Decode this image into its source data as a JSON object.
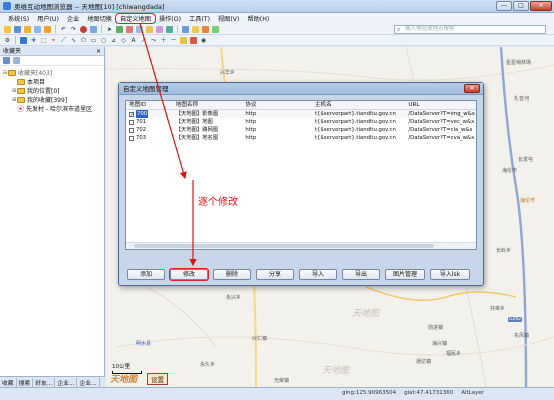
{
  "window": {
    "title": "奥维互动地图浏览器 -- 天地图[10] [chiwangdada]",
    "buttons": [
      "—",
      "□",
      "✕"
    ]
  },
  "menu": {
    "items": [
      "系统(S)",
      "用户(U)",
      "企业",
      "地图切换",
      "自定义地图",
      "操作(O)",
      "工具(T)",
      "视图(V)",
      "帮助(H)"
    ],
    "highlighted_index": 4
  },
  "search": {
    "placeholder": "输入地址或地点搜索"
  },
  "left_panel": {
    "header": "收藏夹",
    "close": "✕",
    "tree": [
      {
        "label": "收藏夹[403]",
        "level": 0,
        "muted": true
      },
      {
        "label": "本项目",
        "level": 1
      },
      {
        "label": "我的位置[0]",
        "level": 1
      },
      {
        "label": "我的收藏[399]",
        "level": 1
      },
      {
        "label": "先发村 - 哈尔滨市道里区",
        "level": 1,
        "pin": true
      }
    ],
    "tabs": [
      "收藏",
      "搜索",
      "好友...",
      "企业...",
      "企业..."
    ]
  },
  "dialog": {
    "title": "自定义地图管理",
    "close": "✕",
    "columns": [
      "地图ID",
      "地图名称",
      "协议",
      "主机名",
      "URL"
    ],
    "rows": [
      {
        "id": "700",
        "name": "【天地图】影像图",
        "protocol": "http",
        "host": "t{$serverpart}.tianditu.gov.cn",
        "url": "/DataServer?T=img_w&x",
        "checked": true,
        "selected": true
      },
      {
        "id": "701",
        "name": "【天地图】地图",
        "protocol": "http",
        "host": "t{$serverpart}.tianditu.gov.cn",
        "url": "/DataServer?T=vec_w&x",
        "checked": false
      },
      {
        "id": "702",
        "name": "【天地图】路网图",
        "protocol": "http",
        "host": "t{$serverpart}.tianditu.gov.cn",
        "url": "/DataServer?T=cia_w&x",
        "checked": false
      },
      {
        "id": "703",
        "name": "【天地图】地名图",
        "protocol": "http",
        "host": "t{$serverpart}.tianditu.gov.cn",
        "url": "/DataServer?T=cva_w&x",
        "checked": false
      }
    ],
    "annotation": "逐个修改",
    "buttons": [
      "添加",
      "修改",
      "删除",
      "分享",
      "导入",
      "导出",
      "图片管理",
      "导入lsk"
    ],
    "highlighted_button_index": 1
  },
  "map": {
    "labels": [
      {
        "text": "兴华乡"
      },
      {
        "text": "星星哨林场"
      },
      {
        "text": "扎音河"
      },
      {
        "text": "长发屯"
      },
      {
        "text": "海伦市",
        "gold": true
      },
      {
        "text": "海伦市"
      },
      {
        "text": "长岭乡"
      },
      {
        "text": "共荣乡"
      },
      {
        "text": "东风镇"
      },
      {
        "text": "前进镇"
      },
      {
        "text": "海兴镇"
      },
      {
        "text": "永兴乡"
      },
      {
        "text": "兴仁镇"
      },
      {
        "text": "明水县"
      },
      {
        "text": "永久乡"
      },
      {
        "text": "通达镇"
      },
      {
        "text": "福民乡"
      },
      {
        "text": "光荣镇"
      }
    ],
    "scale": "10公里",
    "logo": "天地图",
    "watermark": "天地图",
    "settings_label": "设置"
  },
  "status": {
    "lng": "glng:125.90963504",
    "lat": "glat:47.41731360",
    "extra": "AltLayer"
  }
}
